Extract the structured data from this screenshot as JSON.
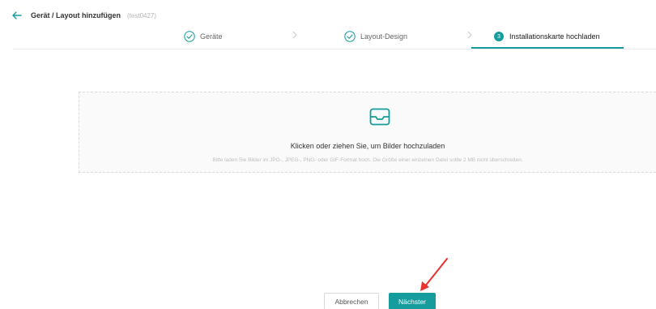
{
  "header": {
    "title": "Gerät / Layout hinzufügen",
    "subtitle": "(test0427)",
    "back_icon": "arrow-left-icon"
  },
  "steps": [
    {
      "label": "Geräte",
      "state": "done"
    },
    {
      "label": "Layout-Design",
      "state": "done"
    },
    {
      "label": "Installationskarte hochladen",
      "state": "active",
      "number": "3"
    }
  ],
  "upload": {
    "icon": "inbox-icon",
    "title": "Klicken oder ziehen Sie, um Bilder hochzuladen",
    "hint": "Bitte laden Sie Bilder im JPG-, JPEG-, PNG- oder GIF-Format hoch. Die Größe einer einzelnen Datei sollte 2 MB nicht überschreiten."
  },
  "buttons": {
    "cancel_label": "Abbrechen",
    "next_label": "Nächster"
  },
  "colors": {
    "accent": "#159c9c",
    "annotation": "#e8322d"
  }
}
